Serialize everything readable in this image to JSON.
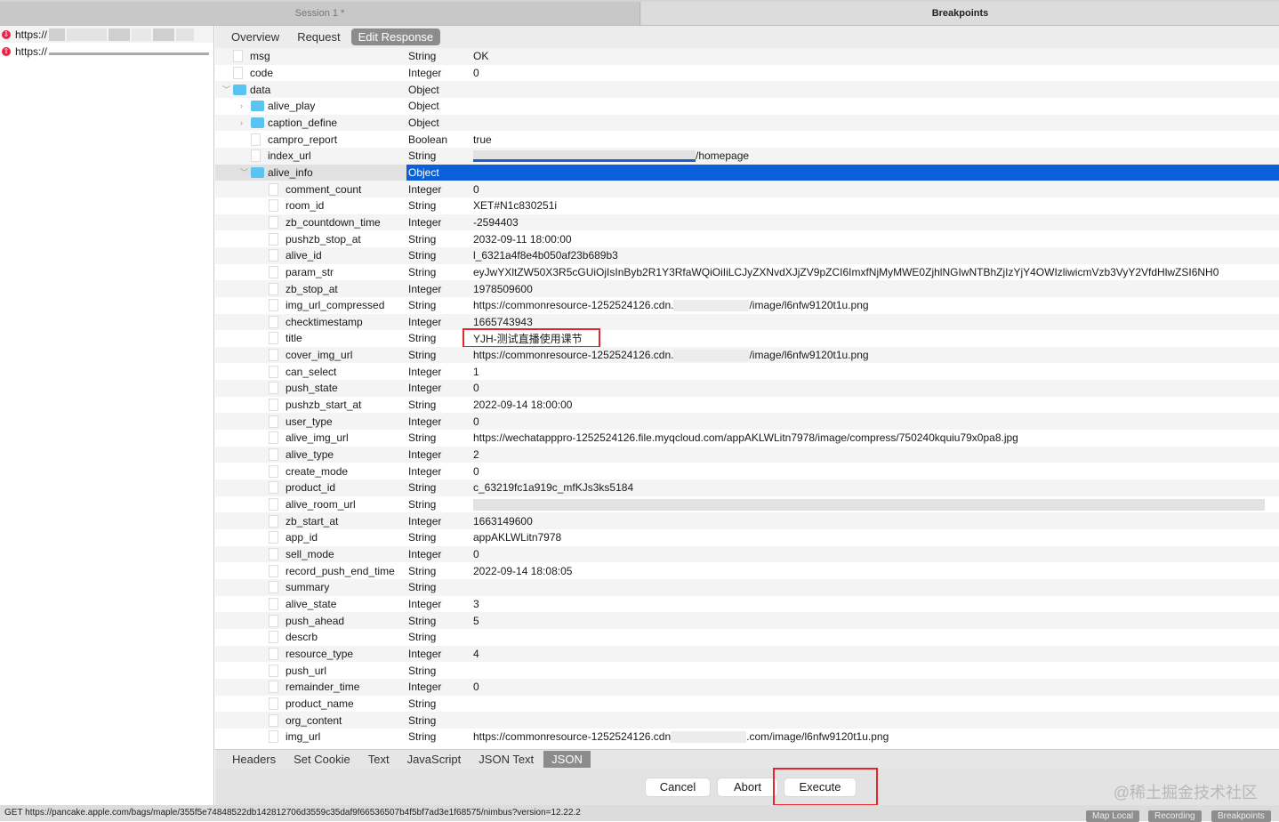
{
  "window": {
    "session_tab": "Session 1 *",
    "breakpoints_tab": "Breakpoints"
  },
  "requests": [
    {
      "url": "https://"
    },
    {
      "url": "https://"
    }
  ],
  "subtabs": [
    "Overview",
    "Request",
    "Edit Response"
  ],
  "active_subtab": 2,
  "rows": [
    {
      "name": "msg",
      "type": "String",
      "value": "OK",
      "depth": 0,
      "icon": "file"
    },
    {
      "name": "code",
      "type": "Integer",
      "value": "0",
      "depth": 0,
      "icon": "file"
    },
    {
      "name": "data",
      "type": "Object",
      "value": "",
      "depth": 0,
      "icon": "folder",
      "expanded": true
    },
    {
      "name": "alive_play",
      "type": "Object",
      "value": "",
      "depth": 1,
      "icon": "folder",
      "expanded": false
    },
    {
      "name": "caption_define",
      "type": "Object",
      "value": "",
      "depth": 1,
      "icon": "folder",
      "expanded": false
    },
    {
      "name": "campro_report",
      "type": "Boolean",
      "value": "true",
      "depth": 1,
      "icon": "file"
    },
    {
      "name": "index_url",
      "type": "String",
      "value": "/homepage",
      "depth": 1,
      "icon": "file",
      "redacted_prefix": 250
    },
    {
      "name": "alive_info",
      "type": "Object",
      "value": "",
      "depth": 1,
      "icon": "folder",
      "expanded": true,
      "selected": true
    },
    {
      "name": "comment_count",
      "type": "Integer",
      "value": "0",
      "depth": 2,
      "icon": "file"
    },
    {
      "name": "room_id",
      "type": "String",
      "value": "XET#N1c830251i",
      "depth": 2,
      "icon": "file"
    },
    {
      "name": "zb_countdown_time",
      "type": "Integer",
      "value": "-2594403",
      "depth": 2,
      "icon": "file"
    },
    {
      "name": "pushzb_stop_at",
      "type": "String",
      "value": "2032-09-11 18:00:00",
      "depth": 2,
      "icon": "file"
    },
    {
      "name": "alive_id",
      "type": "String",
      "value": "l_6321a4f8e4b050af23b689b3",
      "depth": 2,
      "icon": "file"
    },
    {
      "name": "param_str",
      "type": "String",
      "value": "eyJwYXltZW50X3R5cGUiOjIsInByb2R1Y3RfaWQiOiIiLCJyZXNvdXJjZV9pZCI6ImxfNjMyMWE0ZjhlNGIwNTBhZjIzYjY4OWIzliwicmVzb3VyY2VfdHlwZSI6NH0",
      "depth": 2,
      "icon": "file"
    },
    {
      "name": "zb_stop_at",
      "type": "Integer",
      "value": "1978509600",
      "depth": 2,
      "icon": "file"
    },
    {
      "name": "img_url_compressed",
      "type": "String",
      "value": "https://commonresource-1252524126.cdn.",
      "value_suffix": "/image/l6nfw9120t1u.png",
      "depth": 2,
      "icon": "file"
    },
    {
      "name": "checktimestamp",
      "type": "Integer",
      "value": "1665743943",
      "depth": 2,
      "icon": "file"
    },
    {
      "name": "title",
      "type": "String",
      "value": "YJH-测试直播使用课节",
      "depth": 2,
      "icon": "file",
      "highlight": true
    },
    {
      "name": "cover_img_url",
      "type": "String",
      "value": "https://commonresource-1252524126.cdn.",
      "value_suffix": "/image/l6nfw9120t1u.png",
      "depth": 2,
      "icon": "file"
    },
    {
      "name": "can_select",
      "type": "Integer",
      "value": "1",
      "depth": 2,
      "icon": "file"
    },
    {
      "name": "push_state",
      "type": "Integer",
      "value": "0",
      "depth": 2,
      "icon": "file"
    },
    {
      "name": "pushzb_start_at",
      "type": "String",
      "value": "2022-09-14 18:00:00",
      "depth": 2,
      "icon": "file"
    },
    {
      "name": "user_type",
      "type": "Integer",
      "value": "0",
      "depth": 2,
      "icon": "file"
    },
    {
      "name": "alive_img_url",
      "type": "String",
      "value": "https://wechatapppro-1252524126.file.myqcloud.com/appAKLWLitn7978/image/compress/750240kquiu79x0pa8.jpg",
      "depth": 2,
      "icon": "file"
    },
    {
      "name": "alive_type",
      "type": "Integer",
      "value": "2",
      "depth": 2,
      "icon": "file"
    },
    {
      "name": "create_mode",
      "type": "Integer",
      "value": "0",
      "depth": 2,
      "icon": "file"
    },
    {
      "name": "product_id",
      "type": "String",
      "value": "c_63219fc1a919c_mfKJs3ks5184",
      "depth": 2,
      "icon": "file"
    },
    {
      "name": "alive_room_url",
      "type": "String",
      "value": "",
      "depth": 2,
      "icon": "file",
      "redacted_full": true
    },
    {
      "name": "zb_start_at",
      "type": "Integer",
      "value": "1663149600",
      "depth": 2,
      "icon": "file"
    },
    {
      "name": "app_id",
      "type": "String",
      "value": "appAKLWLitn7978",
      "depth": 2,
      "icon": "file"
    },
    {
      "name": "sell_mode",
      "type": "Integer",
      "value": "0",
      "depth": 2,
      "icon": "file"
    },
    {
      "name": "record_push_end_time",
      "type": "String",
      "value": "2022-09-14 18:08:05",
      "depth": 2,
      "icon": "file"
    },
    {
      "name": "summary",
      "type": "String",
      "value": "",
      "depth": 2,
      "icon": "file"
    },
    {
      "name": "alive_state",
      "type": "Integer",
      "value": "3",
      "depth": 2,
      "icon": "file"
    },
    {
      "name": "push_ahead",
      "type": "String",
      "value": "5",
      "depth": 2,
      "icon": "file"
    },
    {
      "name": "descrb",
      "type": "String",
      "value": "",
      "depth": 2,
      "icon": "file"
    },
    {
      "name": "resource_type",
      "type": "Integer",
      "value": "4",
      "depth": 2,
      "icon": "file"
    },
    {
      "name": "push_url",
      "type": "String",
      "value": "",
      "depth": 2,
      "icon": "file"
    },
    {
      "name": "remainder_time",
      "type": "Integer",
      "value": "0",
      "depth": 2,
      "icon": "file"
    },
    {
      "name": "product_name",
      "type": "String",
      "value": "",
      "depth": 2,
      "icon": "file"
    },
    {
      "name": "org_content",
      "type": "String",
      "value": "",
      "depth": 2,
      "icon": "file"
    },
    {
      "name": "img_url",
      "type": "String",
      "value": "https://commonresource-1252524126.cdn",
      "value_suffix": ".com/image/l6nfw9120t1u.png",
      "depth": 2,
      "icon": "file"
    }
  ],
  "bottom_tabs": [
    "Headers",
    "Set Cookie",
    "Text",
    "JavaScript",
    "JSON Text",
    "JSON"
  ],
  "active_bottom_tab": 5,
  "buttons": {
    "cancel": "Cancel",
    "abort": "Abort",
    "execute": "Execute"
  },
  "watermark": "@稀土掘金技术社区",
  "status": {
    "text": "GET https://pancake.apple.com/bags/maple/355f5e74848522db142812706d3559c35daf9f66536507b4f5bf7ad3e1f68575/nimbus?version=12.22.2",
    "map_local": "Map Local",
    "recording": "Recording",
    "breakpoints": "Breakpoints"
  }
}
